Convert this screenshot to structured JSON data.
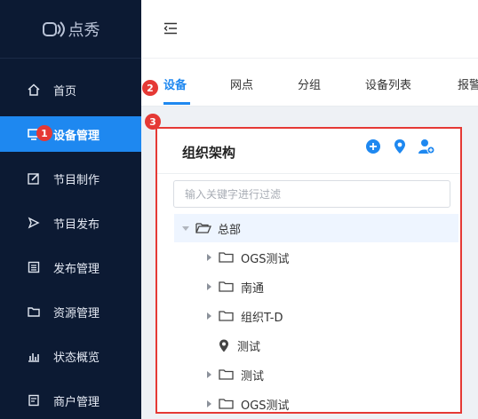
{
  "app": {
    "logo_text": "点秀"
  },
  "sidebar": {
    "items": [
      {
        "label": "首页",
        "icon": "home-icon"
      },
      {
        "label": "设备管理",
        "icon": "device-icon",
        "active": true
      },
      {
        "label": "节目制作",
        "icon": "edit-icon"
      },
      {
        "label": "节目发布",
        "icon": "send-icon"
      },
      {
        "label": "发布管理",
        "icon": "list-icon"
      },
      {
        "label": "资源管理",
        "icon": "folder-icon"
      },
      {
        "label": "状态概览",
        "icon": "chart-icon"
      },
      {
        "label": "商户管理",
        "icon": "merchant-icon"
      }
    ]
  },
  "tabs": [
    {
      "label": "设备",
      "active": true
    },
    {
      "label": "网点"
    },
    {
      "label": "分组"
    },
    {
      "label": "设备列表"
    },
    {
      "label": "报警"
    }
  ],
  "panel": {
    "title": "组织架构",
    "filter_placeholder": "输入关键字进行过滤",
    "tree": [
      {
        "label": "总部",
        "level": 0,
        "expanded": true,
        "icon": "folder-open-icon"
      },
      {
        "label": "OGS测试",
        "level": 1,
        "icon": "folder-icon"
      },
      {
        "label": "南通",
        "level": 1,
        "icon": "folder-icon"
      },
      {
        "label": "组织T-D",
        "level": 1,
        "icon": "folder-icon"
      },
      {
        "label": "测试",
        "level": 1,
        "icon": "location-pin-icon",
        "leaf": true
      },
      {
        "label": "测试",
        "level": 1,
        "icon": "folder-icon"
      },
      {
        "label": "OGS测试",
        "level": 1,
        "icon": "folder-icon"
      }
    ]
  },
  "badges": [
    "1",
    "2",
    "3"
  ],
  "colors": {
    "sidebar_bg": "#0c1a33",
    "accent": "#1e88f0",
    "annotation": "#e53935"
  }
}
